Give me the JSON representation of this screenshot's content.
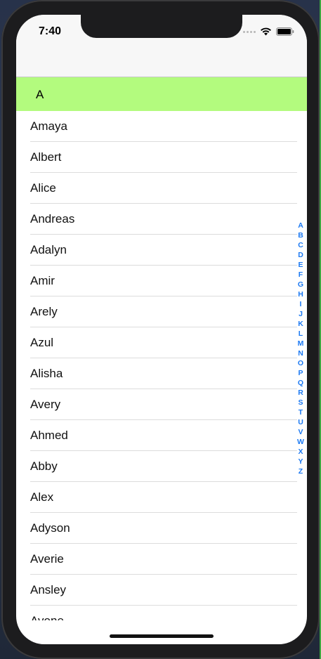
{
  "status_bar": {
    "time": "7:40"
  },
  "section": {
    "header": "A"
  },
  "contacts": [
    "Amaya",
    "Albert",
    "Alice",
    "Andreas",
    "Adalyn",
    "Amir",
    "Arely",
    "Azul",
    "Alisha",
    "Avery",
    "Ahmed",
    "Abby",
    "Alex",
    "Adyson",
    "Averie",
    "Ansley",
    "Avone"
  ],
  "index_letters": [
    "A",
    "B",
    "C",
    "D",
    "E",
    "F",
    "G",
    "H",
    "I",
    "J",
    "K",
    "L",
    "M",
    "N",
    "O",
    "P",
    "Q",
    "R",
    "S",
    "T",
    "U",
    "V",
    "W",
    "X",
    "Y",
    "Z"
  ],
  "colors": {
    "section_header_bg": "#b3fb7e",
    "index_tint": "#1d7af3"
  }
}
